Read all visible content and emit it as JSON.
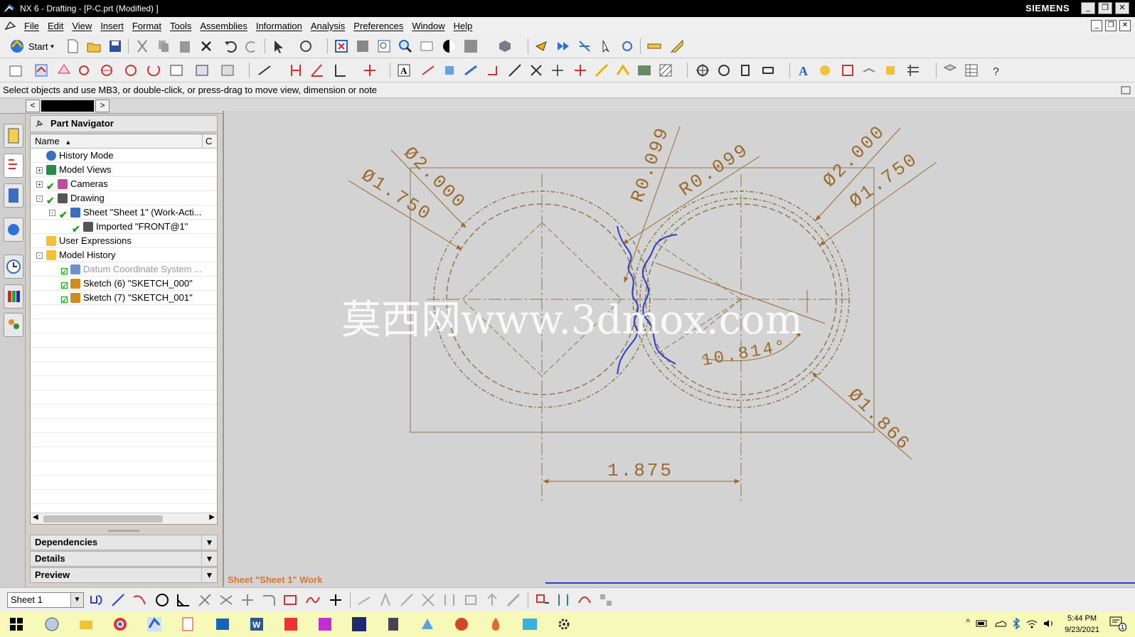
{
  "window": {
    "title": "NX 6 - Drafting - [P-C.prt (Modified) ]",
    "brand": "SIEMENS"
  },
  "menu": [
    "File",
    "Edit",
    "View",
    "Insert",
    "Format",
    "Tools",
    "Assemblies",
    "Information",
    "Analysis",
    "Preferences",
    "Window",
    "Help"
  ],
  "toolbar": {
    "start_label": "Start"
  },
  "cue_line": "Select objects and use MB3, or double-click, or press-drag to move view, dimension or note",
  "part_navigator": {
    "title": "Part Navigator",
    "col_name": "Name",
    "col_c": "C",
    "tree": [
      {
        "label": "History Mode",
        "indent": 0,
        "icon": "clock-icon"
      },
      {
        "label": "Model Views",
        "indent": 0,
        "icon": "views-icon",
        "expand": "+"
      },
      {
        "label": "Cameras",
        "indent": 0,
        "icon": "camera-icon",
        "expand": "+",
        "check": true
      },
      {
        "label": "Drawing",
        "indent": 0,
        "icon": "drawing-icon",
        "expand": "-",
        "check": true
      },
      {
        "label": "Sheet \"Sheet 1\" (Work-Acti...",
        "indent": 1,
        "icon": "sheet-icon",
        "expand": "-",
        "check": true
      },
      {
        "label": "Imported \"FRONT@1\"",
        "indent": 2,
        "icon": "view-icon",
        "check": true
      },
      {
        "label": "User Expressions",
        "indent": 0,
        "icon": "folder-icon"
      },
      {
        "label": "Model History",
        "indent": 0,
        "icon": "folder-icon",
        "expand": "-"
      },
      {
        "label": "Datum Coordinate System ...",
        "indent": 1,
        "icon": "datum-icon",
        "box": true,
        "grey": true
      },
      {
        "label": "Sketch (6) \"SKETCH_000\"",
        "indent": 1,
        "icon": "sketch-icon",
        "box": true
      },
      {
        "label": "Sketch (7) \"SKETCH_001\"",
        "indent": 1,
        "icon": "sketch-icon",
        "box": true
      }
    ],
    "panels": [
      "Dependencies",
      "Details",
      "Preview"
    ]
  },
  "drawing": {
    "dims": {
      "left_small_dia": "Ø1.750",
      "left_big_dia": "Ø2.000",
      "r1": "R0.099",
      "r2": "R0.099",
      "right_big_dia": "Ø2.000",
      "right_small_dia": "Ø1.750",
      "angle": "10.814°",
      "right_outer_dia": "Ø1.866",
      "center_dist": "1.875"
    },
    "watermark": "莫西网www.3dmox.com",
    "sheet_label": "Sheet \"Sheet 1\" Work",
    "colors": {
      "dim": "#9a6a2e",
      "geometry": "#8a7a50",
      "sketch": "#2a3fd0",
      "background": "#d3d3d3"
    }
  },
  "bottom_toolbar": {
    "sheet_value": "Sheet 1"
  },
  "taskbar": {
    "time": "5:44 PM",
    "date": "9/23/2021",
    "notification_count": "1"
  }
}
